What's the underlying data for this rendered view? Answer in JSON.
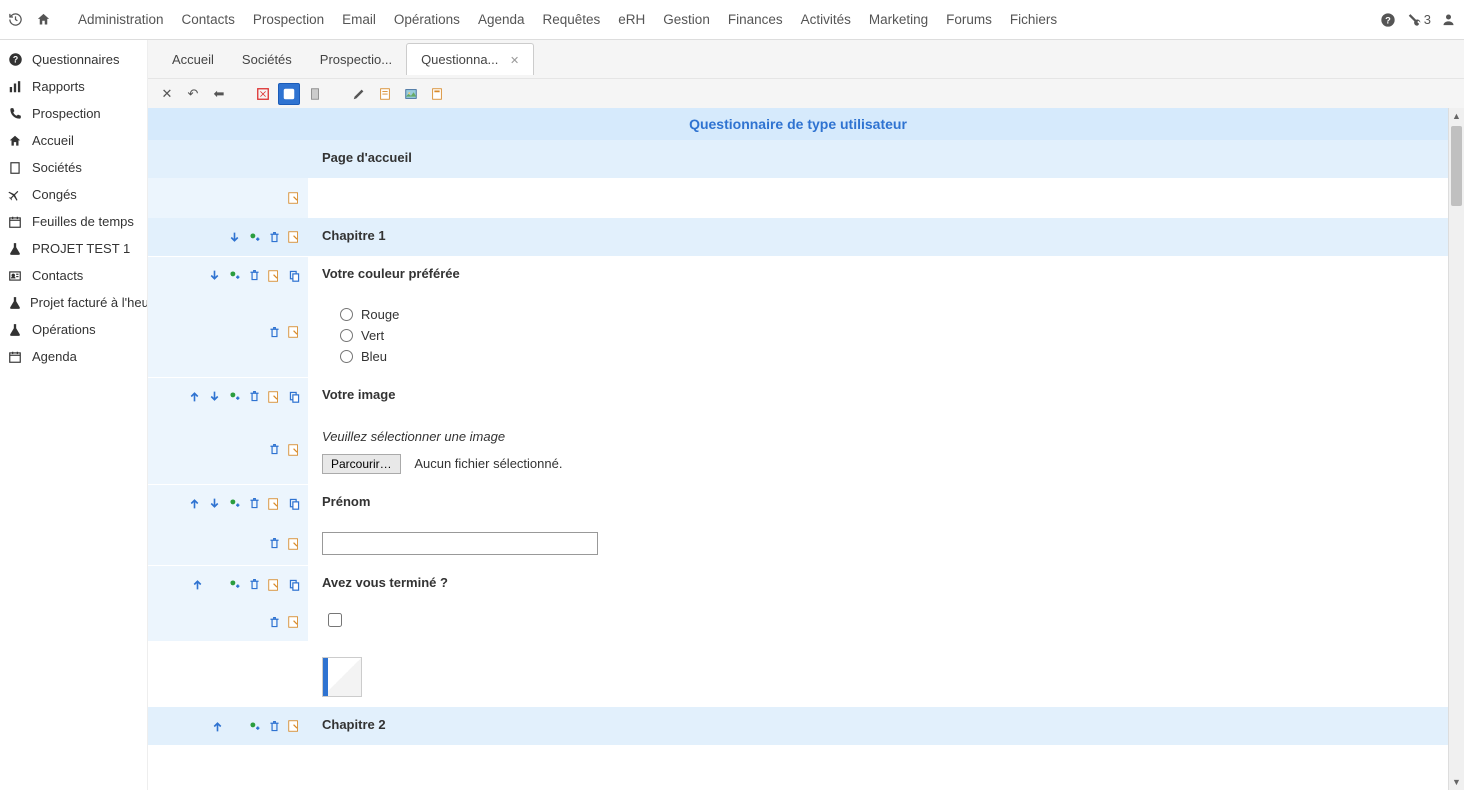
{
  "topnav": {
    "menu": [
      "Administration",
      "Contacts",
      "Prospection",
      "Email",
      "Opérations",
      "Agenda",
      "Requêtes",
      "eRH",
      "Gestion",
      "Finances",
      "Activités",
      "Marketing",
      "Forums",
      "Fichiers"
    ],
    "notif_count": "3"
  },
  "sidebar": {
    "items": [
      {
        "icon": "question",
        "label": "Questionnaires"
      },
      {
        "icon": "chart",
        "label": "Rapports"
      },
      {
        "icon": "phone",
        "label": "Prospection"
      },
      {
        "icon": "home",
        "label": "Accueil"
      },
      {
        "icon": "building",
        "label": "Sociétés"
      },
      {
        "icon": "plane",
        "label": "Congés"
      },
      {
        "icon": "calendar",
        "label": "Feuilles de temps"
      },
      {
        "icon": "flask",
        "label": "PROJET TEST 1"
      },
      {
        "icon": "idcard",
        "label": "Contacts"
      },
      {
        "icon": "flask",
        "label": "Projet facturé à l'heu"
      },
      {
        "icon": "flask",
        "label": "Opérations"
      },
      {
        "icon": "calendar",
        "label": "Agenda"
      }
    ]
  },
  "tabs": {
    "items": [
      "Accueil",
      "Sociétés",
      "Prospectio...",
      "Questionna..."
    ],
    "active_index": 3
  },
  "page": {
    "title": "Questionnaire de type utilisateur",
    "home_section": "Page d'accueil",
    "chapter1": "Chapitre 1",
    "chapter2": "Chapitre 2",
    "q_color": "Votre couleur préférée",
    "opt_red": "Rouge",
    "opt_green": "Vert",
    "opt_blue": "Bleu",
    "q_image": "Votre image",
    "image_hint": "Veuillez sélectionner une image",
    "browse_label": "Parcourir…",
    "no_file": "Aucun fichier sélectionné.",
    "q_firstname": "Prénom",
    "q_done": "Avez vous terminé ?"
  }
}
